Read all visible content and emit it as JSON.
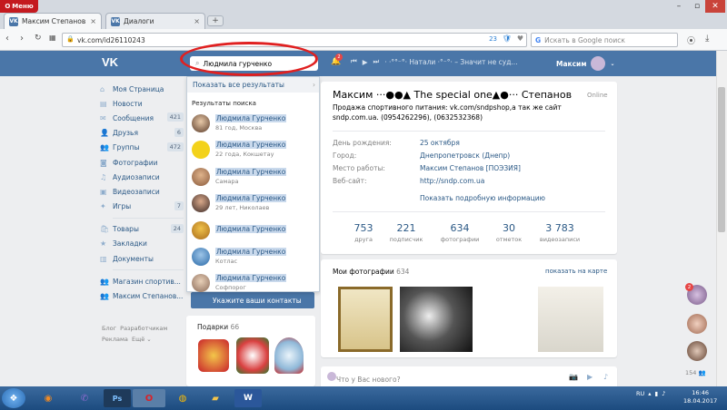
{
  "browser": {
    "menu_label": "Меню",
    "tabs": [
      {
        "title": "Максим Степанов",
        "close": "×"
      },
      {
        "title": "Диалоги",
        "close": "×"
      }
    ],
    "new_tab": "+",
    "url": "vk.com/id26110243",
    "url_badge": "23",
    "search_placeholder": "Искать в Google поиск"
  },
  "vk_header": {
    "logo": "VK",
    "search_value": "Людмила гурченко",
    "notif_count": "2",
    "player_text": "· ·°°⁻°· Натали ·°⁻°· – Значит не суд...",
    "user_name": "Максим"
  },
  "sidebar": {
    "items": [
      {
        "label": "Моя Страница",
        "icon": "home-icon",
        "count": ""
      },
      {
        "label": "Новости",
        "icon": "news-icon",
        "count": ""
      },
      {
        "label": "Сообщения",
        "icon": "messages-icon",
        "count": "421"
      },
      {
        "label": "Друзья",
        "icon": "friends-icon",
        "count": "6"
      },
      {
        "label": "Группы",
        "icon": "groups-icon",
        "count": "472"
      },
      {
        "label": "Фотографии",
        "icon": "photos-icon",
        "count": ""
      },
      {
        "label": "Аудиозаписи",
        "icon": "audio-icon",
        "count": ""
      },
      {
        "label": "Видеозаписи",
        "icon": "video-icon",
        "count": ""
      },
      {
        "label": "Игры",
        "icon": "games-icon",
        "count": "7"
      }
    ],
    "items2": [
      {
        "label": "Товары",
        "icon": "goods-icon",
        "count": "24"
      },
      {
        "label": "Закладки",
        "icon": "bookmarks-icon",
        "count": ""
      },
      {
        "label": "Документы",
        "icon": "documents-icon",
        "count": ""
      }
    ],
    "items3": [
      {
        "label": "Магазин спортив...",
        "icon": "shop-icon"
      },
      {
        "label": "Максим Степанов...",
        "icon": "page-icon"
      }
    ],
    "footer": [
      "Блог",
      "Разработчикам",
      "Реклама",
      "Ещё ⌄"
    ]
  },
  "search_dropdown": {
    "show_all": "Показать все результаты",
    "results_header": "Результаты поиска",
    "results": [
      {
        "name": "Людмила Гурченко",
        "sub": "81 год, Москва"
      },
      {
        "name": "Людмила Гурченко",
        "sub": "22 года, Кокшетау"
      },
      {
        "name": "Людмила Гурченко",
        "sub": "Самара"
      },
      {
        "name": "Людмила Гурченко",
        "sub": "29 лет, Николаев"
      },
      {
        "name": "Людмила Гурченко",
        "sub": ""
      },
      {
        "name": "Людмила Гурченко",
        "sub": "Котлас"
      },
      {
        "name": "Людмила Гурченко",
        "sub": "Софпорог"
      }
    ]
  },
  "left_column": {
    "under_button": "Укажите ваши контакты",
    "gifts_label": "Подарки",
    "gifts_count": "66"
  },
  "profile": {
    "name": "Максим ·‧·●●▲ The special one▲●‧·· Степанов",
    "online": "Online",
    "status": "Продажа спортивного питания: vk.com/sndpshop,а так же сайт sndp.com.ua. (0954262296), (0632532368)",
    "rows": [
      {
        "key": "День рождения:",
        "value": "25 октября"
      },
      {
        "key": "Город:",
        "value": "Днепропетровск (Днепр)"
      },
      {
        "key": "Место работы:",
        "value": "Максим Степанов [ПОЭЗИЯ]"
      },
      {
        "key": "Веб-сайт:",
        "value": "http://sndp.com.ua"
      }
    ],
    "more_info": "Показать подробную информацию",
    "stats": [
      {
        "n": "753",
        "l": "друга"
      },
      {
        "n": "221",
        "l": "подписчик"
      },
      {
        "n": "634",
        "l": "фотографии"
      },
      {
        "n": "30",
        "l": "отметок"
      },
      {
        "n": "3 783",
        "l": "видеозаписи"
      }
    ]
  },
  "photos": {
    "title": "Мои фотографии",
    "count": "634",
    "show_map": "показать на карте"
  },
  "post": {
    "placeholder": "Что у Вас нового?"
  },
  "chats": {
    "badge": "2",
    "count": "154"
  },
  "taskbar": {
    "lang": "RU",
    "time": "16:46",
    "date": "18.04.2017"
  }
}
